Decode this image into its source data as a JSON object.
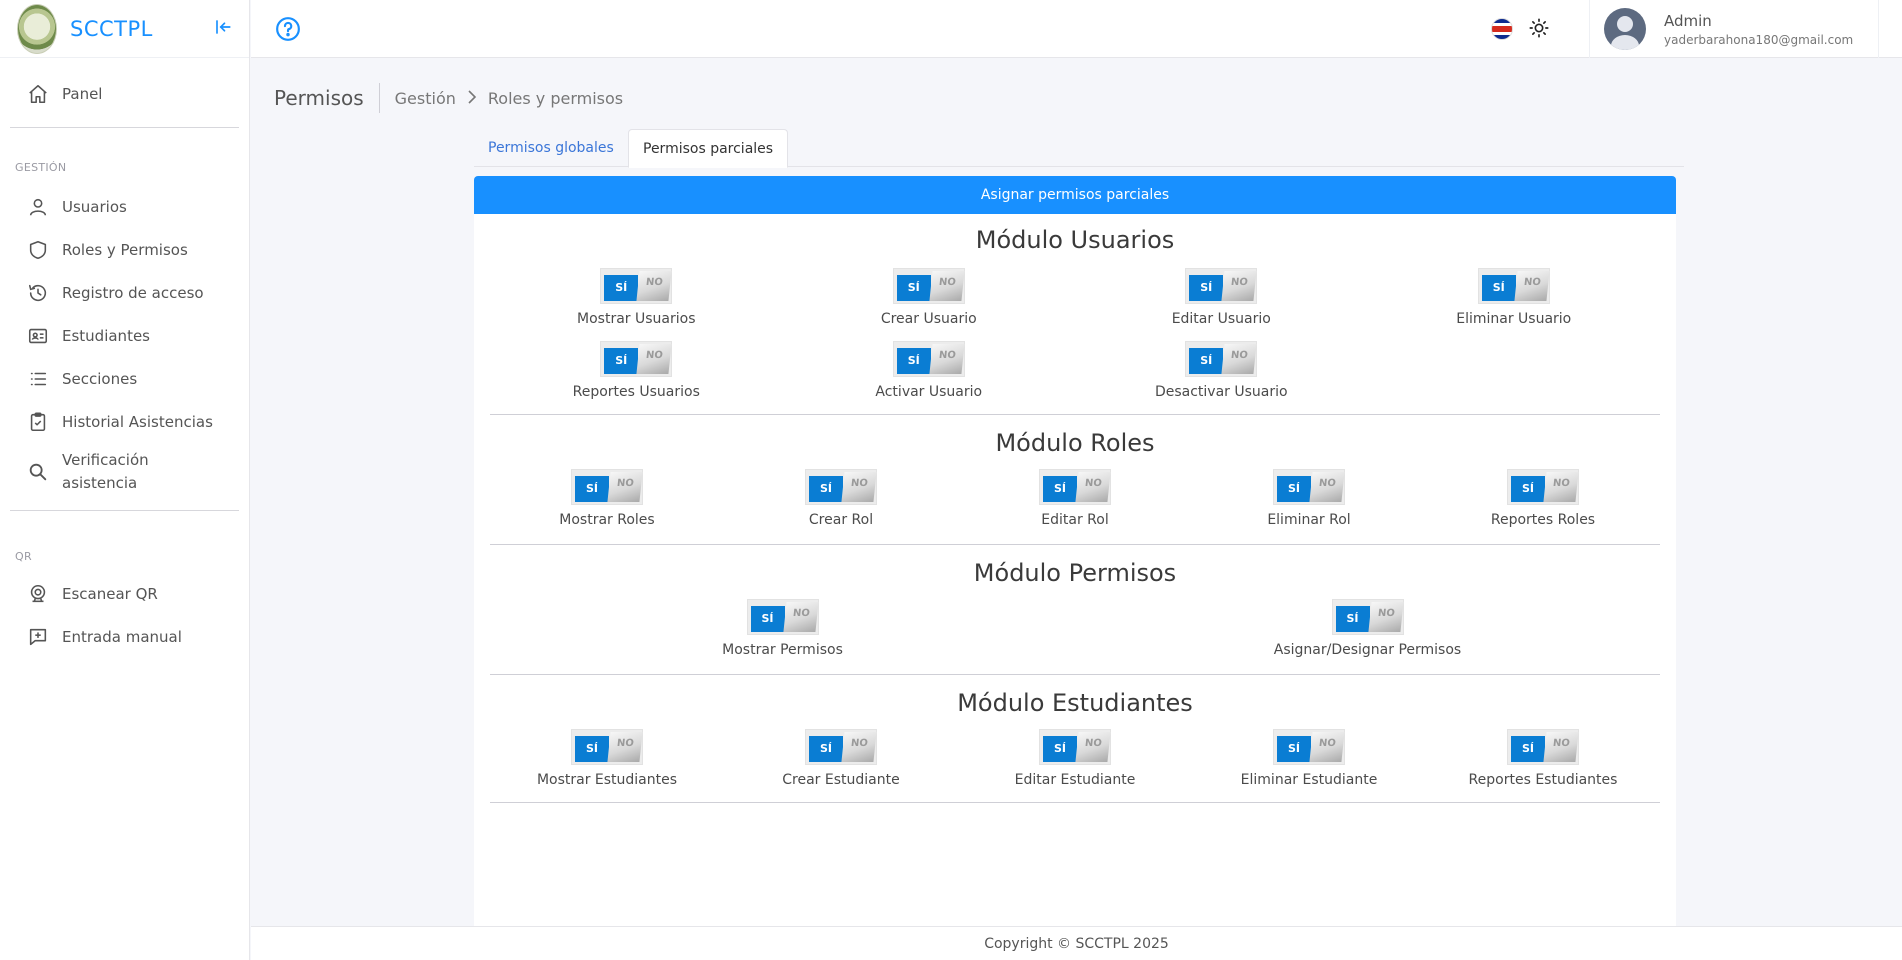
{
  "brand": {
    "name": "SCCTPL"
  },
  "sidebar": {
    "top_item": {
      "label": "Panel",
      "icon": "home-icon"
    },
    "gestion_label": "GESTIÓN",
    "gestion_items": [
      {
        "label": "Usuarios",
        "icon": "user-icon"
      },
      {
        "label": "Roles y Permisos",
        "icon": "shield-icon"
      },
      {
        "label": "Registro de acceso",
        "icon": "history-icon"
      },
      {
        "label": "Estudiantes",
        "icon": "id-card-icon"
      },
      {
        "label": "Secciones",
        "icon": "list-icon"
      },
      {
        "label": "Historial Asistencias",
        "icon": "clipboard-check-icon"
      },
      {
        "label": "Verificación asistencia",
        "icon": "search-icon"
      }
    ],
    "qr_label": "QR",
    "qr_items": [
      {
        "label": "Escanear QR",
        "icon": "webcam-icon"
      },
      {
        "label": "Entrada manual",
        "icon": "message-plus-icon"
      }
    ]
  },
  "header": {
    "user_name": "Admin",
    "user_email": "yaderbarahona180@gmail.com"
  },
  "breadcrumb": {
    "title": "Permisos",
    "parent": "Gestión",
    "separator": "›",
    "current": "Roles y permisos"
  },
  "tabs": [
    "Permisos globales",
    "Permisos parciales"
  ],
  "card": {
    "title": "Asignar permisos parciales",
    "toggle_on": "SÍ",
    "toggle_off": "NO",
    "modules": [
      {
        "title": "Módulo Usuarios",
        "rows": [
          [
            "Mostrar Usuarios",
            "Crear Usuario",
            "Editar Usuario",
            "Eliminar Usuario"
          ],
          [
            "Reportes Usuarios",
            "Activar Usuario",
            "Desactivar Usuario"
          ]
        ]
      },
      {
        "title": "Módulo Roles",
        "rows": [
          [
            "Mostrar Roles",
            "Crear Rol",
            "Editar Rol",
            "Eliminar Rol",
            "Reportes Roles"
          ]
        ]
      },
      {
        "title": "Módulo Permisos",
        "rows": [
          [
            "Mostrar Permisos",
            "Asignar/Designar Permisos"
          ]
        ]
      },
      {
        "title": "Módulo Estudiantes",
        "rows": [
          [
            "Mostrar Estudiantes",
            "Crear Estudiante",
            "Editar Estudiante",
            "Eliminar Estudiante",
            "Reportes Estudiantes"
          ]
        ]
      }
    ]
  },
  "footer": {
    "text": "Copyright © SCCTPL 2025"
  },
  "colors": {
    "accent": "#1890ff",
    "toggle_on": "#0a7dd3"
  }
}
